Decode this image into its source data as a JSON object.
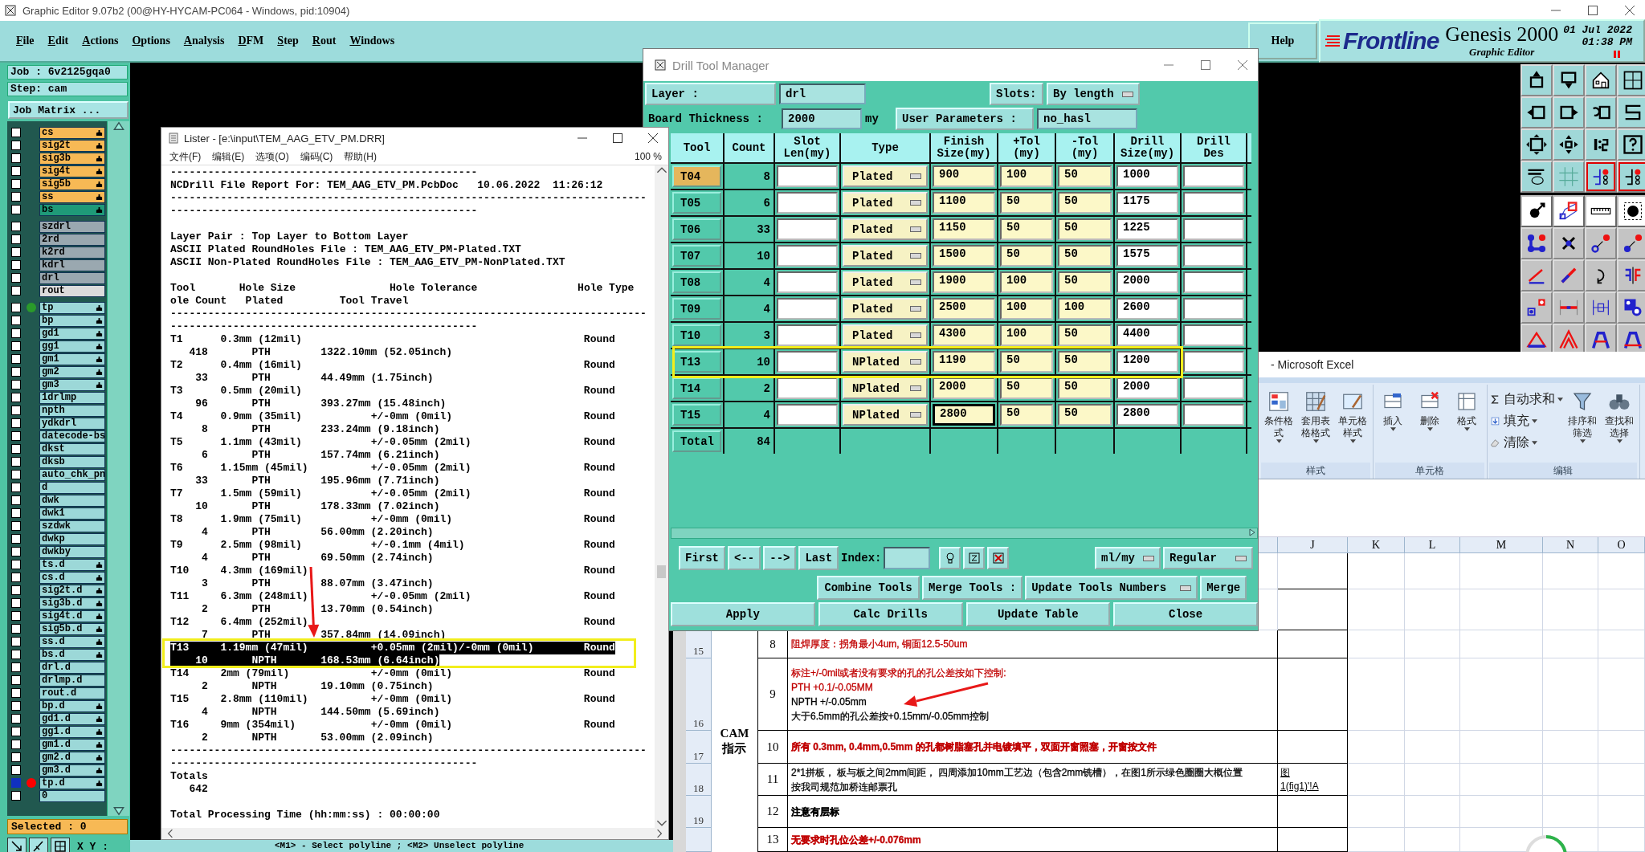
{
  "window": {
    "title": "Graphic Editor 9.07b2 (00@HY-HYCAM-PC064 - Windows, pid:10904)"
  },
  "menu": [
    "File",
    "Edit",
    "Actions",
    "Options",
    "Analysis",
    "DFM",
    "Step",
    "Rout",
    "Windows"
  ],
  "help": "Help",
  "brand": {
    "logo": "Frontline",
    "product": "Genesis 2000",
    "subtitle": "Graphic Editor",
    "date": "01 Jul 2022",
    "time": "01:38 PM"
  },
  "job": {
    "job": "Job : 6v2125gqa0",
    "step": "Step: cam",
    "matrix_button": "Job Matrix ...",
    "selected": "Selected : 0",
    "xy_label": "X Y :"
  },
  "layer_groups": [
    {
      "layers": [
        {
          "name": "cs",
          "kind": "board",
          "affected": true,
          "checked": false,
          "selected": false
        },
        {
          "name": "sig2t",
          "kind": "board",
          "affected": true,
          "checked": false,
          "selected": false
        },
        {
          "name": "sig3b",
          "kind": "board",
          "affected": true,
          "checked": false,
          "selected": false
        },
        {
          "name": "sig4t",
          "kind": "board",
          "affected": true,
          "checked": false,
          "selected": false
        },
        {
          "name": "sig5b",
          "kind": "board",
          "affected": true,
          "checked": false,
          "selected": false
        },
        {
          "name": "ss",
          "kind": "board",
          "affected": true,
          "checked": false,
          "selected": false
        },
        {
          "name": "bs",
          "kind": "board",
          "affected": true,
          "checked": false,
          "selected": true
        }
      ]
    },
    {
      "layers": [
        {
          "name": "szdrl",
          "kind": "drill",
          "affected": false,
          "checked": false,
          "selected": false
        },
        {
          "name": "2rd",
          "kind": "drill",
          "affected": false,
          "checked": false,
          "selected": false
        },
        {
          "name": "k2rd",
          "kind": "drill",
          "affected": false,
          "checked": false,
          "selected": false
        },
        {
          "name": "kdrl",
          "kind": "drill",
          "affected": false,
          "checked": false,
          "selected": false
        },
        {
          "name": "drl",
          "kind": "drill",
          "affected": false,
          "checked": false,
          "selected": false
        },
        {
          "name": "rout",
          "kind": "rout",
          "affected": false,
          "checked": false,
          "selected": false
        }
      ]
    },
    {
      "layers": [
        {
          "name": "tp",
          "kind": "misc",
          "affected": true,
          "checked": false,
          "selected": false,
          "color": "#2a9a2a"
        },
        {
          "name": "bp",
          "kind": "misc",
          "affected": true,
          "checked": false,
          "selected": false
        },
        {
          "name": "gd1",
          "kind": "misc",
          "affected": true,
          "checked": false,
          "selected": false
        },
        {
          "name": "gg1",
          "kind": "misc",
          "affected": true,
          "checked": false,
          "selected": false
        },
        {
          "name": "gm1",
          "kind": "misc",
          "affected": true,
          "checked": false,
          "selected": false
        },
        {
          "name": "gm2",
          "kind": "misc",
          "affected": true,
          "checked": false,
          "selected": false
        },
        {
          "name": "gm3",
          "kind": "misc",
          "affected": true,
          "checked": false,
          "selected": false
        },
        {
          "name": "1drlmp",
          "kind": "misc",
          "affected": false,
          "checked": false,
          "selected": false
        },
        {
          "name": "npth",
          "kind": "misc",
          "affected": false,
          "checked": false,
          "selected": false
        },
        {
          "name": "ydkdrl",
          "kind": "misc",
          "affected": false,
          "checked": false,
          "selected": false
        },
        {
          "name": "datecode-bs",
          "kind": "misc",
          "affected": false,
          "checked": false,
          "selected": false
        },
        {
          "name": "dkst",
          "kind": "misc",
          "affected": false,
          "checked": false,
          "selected": false
        },
        {
          "name": "dksb",
          "kind": "misc",
          "affected": false,
          "checked": false,
          "selected": false
        },
        {
          "name": "auto_chk_pn",
          "kind": "misc",
          "affected": false,
          "checked": false,
          "selected": false
        },
        {
          "name": "d",
          "kind": "misc",
          "affected": false,
          "checked": false,
          "selected": false
        },
        {
          "name": "dwk",
          "kind": "misc",
          "affected": false,
          "checked": false,
          "selected": false
        },
        {
          "name": "dwk1",
          "kind": "misc",
          "affected": false,
          "checked": false,
          "selected": false
        },
        {
          "name": "szdwk",
          "kind": "misc",
          "affected": false,
          "checked": false,
          "selected": false
        },
        {
          "name": "dwkp",
          "kind": "misc",
          "affected": false,
          "checked": false,
          "selected": false
        },
        {
          "name": "dwkby",
          "kind": "misc",
          "affected": false,
          "checked": false,
          "selected": false
        },
        {
          "name": "ts.d",
          "kind": "misc",
          "affected": true,
          "checked": false,
          "selected": false
        },
        {
          "name": "cs.d",
          "kind": "misc",
          "affected": true,
          "checked": false,
          "selected": false
        },
        {
          "name": "sig2t.d",
          "kind": "misc",
          "affected": true,
          "checked": false,
          "selected": false
        },
        {
          "name": "sig3b.d",
          "kind": "misc",
          "affected": true,
          "checked": false,
          "selected": false
        },
        {
          "name": "sig4t.d",
          "kind": "misc",
          "affected": true,
          "checked": false,
          "selected": false
        },
        {
          "name": "sig5b.d",
          "kind": "misc",
          "affected": true,
          "checked": false,
          "selected": false
        },
        {
          "name": "ss.d",
          "kind": "misc",
          "affected": true,
          "checked": false,
          "selected": false
        },
        {
          "name": "bs.d",
          "kind": "misc",
          "affected": true,
          "checked": false,
          "selected": false
        },
        {
          "name": "drl.d",
          "kind": "misc",
          "affected": false,
          "checked": false,
          "selected": false
        },
        {
          "name": "drlmp.d",
          "kind": "misc",
          "affected": false,
          "checked": false,
          "selected": false
        },
        {
          "name": "rout.d",
          "kind": "misc",
          "affected": false,
          "checked": false,
          "selected": false
        },
        {
          "name": "bp.d",
          "kind": "misc",
          "affected": true,
          "checked": false,
          "selected": false
        },
        {
          "name": "gd1.d",
          "kind": "misc",
          "affected": true,
          "checked": false,
          "selected": false
        },
        {
          "name": "gg1.d",
          "kind": "misc",
          "affected": true,
          "checked": false,
          "selected": false
        },
        {
          "name": "gm1.d",
          "kind": "misc",
          "affected": true,
          "checked": false,
          "selected": false
        },
        {
          "name": "gm2.d",
          "kind": "misc",
          "affected": true,
          "checked": false,
          "selected": false
        },
        {
          "name": "gm3.d",
          "kind": "misc",
          "affected": true,
          "checked": false,
          "selected": false
        },
        {
          "name": "tp.d",
          "kind": "misc",
          "affected": true,
          "checked": true,
          "selected": false,
          "color": "#ff0000"
        },
        {
          "name": "0",
          "kind": "misc",
          "affected": false,
          "checked": false,
          "selected": false
        }
      ]
    }
  ],
  "lister": {
    "title": "Lister - [e:\\input\\TEM_AAG_ETV_PM.DRR]",
    "menu": [
      "文件(F)",
      "编辑(E)",
      "选项(O)",
      "编码(C)",
      "帮助(H)"
    ],
    "zoom": "100 %",
    "body": [
      {
        "kind": "text",
        "text": "-------------------------------------------------"
      },
      {
        "kind": "text",
        "text": "NCDrill File Report For: TEM_AAG_ETV_PM.PcbDoc   10.06.2022  11:26:12"
      },
      {
        "kind": "text",
        "text": "----------------------------------------------------------------------------"
      },
      {
        "kind": "text",
        "text": "-------------------------------------------------"
      },
      {
        "kind": "blank"
      },
      {
        "kind": "text",
        "text": "Layer Pair : Top Layer to Bottom Layer"
      },
      {
        "kind": "text",
        "text": "ASCII Plated RoundHoles File : TEM_AAG_ETV_PM-Plated.TXT"
      },
      {
        "kind": "text",
        "text": "ASCII Non-Plated RoundHoles File : TEM_AAG_ETV_PM-NonPlated.TXT"
      },
      {
        "kind": "blank"
      },
      {
        "kind": "text",
        "text": "Tool       Hole Size               Hole Tolerance                Hole Type"
      },
      {
        "kind": "text",
        "text": "ole Count   Plated         Tool Travel"
      },
      {
        "kind": "text",
        "text": "----------------------------------------------------------------------------"
      },
      {
        "kind": "text",
        "text": "-------------------------------------------------"
      },
      {
        "kind": "tool",
        "tool": "T1",
        "size": "0.3mm (12mil)",
        "type": "Round",
        "count": "418",
        "plating": "PTH",
        "travel": "1322.10mm (52.05inch)",
        "selected": false
      },
      {
        "kind": "tool",
        "tool": "T2",
        "size": "0.4mm (16mil)",
        "type": "Round",
        "count": "33",
        "plating": "PTH",
        "travel": "44.49mm (1.75inch)",
        "selected": false
      },
      {
        "kind": "tool",
        "tool": "T3",
        "size": "0.5mm (20mil)",
        "type": "Round",
        "count": "96",
        "plating": "PTH",
        "travel": "393.27mm (15.48inch)",
        "selected": false
      },
      {
        "kind": "tool",
        "tool": "T4",
        "size": "0.9mm (35mil)",
        "tolerance": "+/-0mm (0mil)",
        "type": "Round",
        "count": "8",
        "plating": "PTH",
        "travel": "233.24mm (9.18inch)",
        "selected": false
      },
      {
        "kind": "tool",
        "tool": "T5",
        "size": "1.1mm (43mil)",
        "tolerance": "+/-0.05mm (2mil)",
        "type": "Round",
        "count": "6",
        "plating": "PTH",
        "travel": "157.74mm (6.21inch)",
        "selected": false
      },
      {
        "kind": "tool",
        "tool": "T6",
        "size": "1.15mm (45mil)",
        "tolerance": "+/-0.05mm (2mil)",
        "type": "Round",
        "count": "33",
        "plating": "PTH",
        "travel": "195.96mm (7.71inch)",
        "selected": false
      },
      {
        "kind": "tool",
        "tool": "T7",
        "size": "1.5mm (59mil)",
        "tolerance": "+/-0.05mm (2mil)",
        "type": "Round",
        "count": "10",
        "plating": "PTH",
        "travel": "178.33mm (7.02inch)",
        "selected": false
      },
      {
        "kind": "tool",
        "tool": "T8",
        "size": "1.9mm (75mil)",
        "tolerance": "+/-0mm (0mil)",
        "type": "Round",
        "count": "4",
        "plating": "PTH",
        "travel": "56.00mm (2.20inch)",
        "selected": false
      },
      {
        "kind": "tool",
        "tool": "T9",
        "size": "2.5mm (98mil)",
        "tolerance": "+/-0.1mm (4mil)",
        "type": "Round",
        "count": "4",
        "plating": "PTH",
        "travel": "69.50mm (2.74inch)",
        "selected": false
      },
      {
        "kind": "tool",
        "tool": "T10",
        "size": "4.3mm (169mil)",
        "type": "Round",
        "count": "3",
        "plating": "PTH",
        "travel": "88.07mm (3.47inch)",
        "selected": false
      },
      {
        "kind": "tool",
        "tool": "T11",
        "size": "6.3mm (248mil)",
        "tolerance": "+/-0.05mm (2mil)",
        "type": "Round",
        "count": "2",
        "plating": "PTH",
        "travel": "13.70mm (0.54inch)",
        "selected": false
      },
      {
        "kind": "tool",
        "tool": "T12",
        "size": "6.4mm (252mil)",
        "type": "Round",
        "count": "7",
        "plating": "PTH",
        "travel": "357.84mm (14.09inch)",
        "selected": false
      },
      {
        "kind": "tool",
        "tool": "T13",
        "size": "1.19mm (47mil)",
        "tolerance": "+0.05mm (2mil)/-0mm (0mil)",
        "type": "Round",
        "count": "10",
        "plating": "NPTH",
        "travel": "168.53mm (6.64inch)",
        "selected": true
      },
      {
        "kind": "tool",
        "tool": "T14",
        "size": "2mm (79mil)",
        "tolerance": "+/-0mm (0mil)",
        "type": "Round",
        "count": "2",
        "plating": "NPTH",
        "travel": "19.10mm (0.75inch)",
        "selected": false
      },
      {
        "kind": "tool",
        "tool": "T15",
        "size": "2.8mm (110mil)",
        "tolerance": "+/-0mm (0mil)",
        "type": "Round",
        "count": "4",
        "plating": "NPTH",
        "travel": "144.50mm (5.69inch)",
        "selected": false
      },
      {
        "kind": "tool",
        "tool": "T16",
        "size": "9mm (354mil)",
        "tolerance": "+/-0mm (0mil)",
        "type": "Round",
        "count": "2",
        "plating": "NPTH",
        "travel": "53.00mm (2.09inch)",
        "selected": false
      },
      {
        "kind": "text",
        "text": "----------------------------------------------------------------------------"
      },
      {
        "kind": "text",
        "text": "-------------------------------------------------"
      },
      {
        "kind": "text",
        "text": "Totals"
      },
      {
        "kind": "text",
        "text": "   642"
      },
      {
        "kind": "blank"
      },
      {
        "kind": "text",
        "text": "Total Processing Time (hh:mm:ss) : 00:00:00"
      }
    ]
  },
  "drill_manager": {
    "title": "Drill Tool Manager",
    "layer_label": "Layer :",
    "layer": "drl",
    "slots_label": "Slots:",
    "slots": "By length",
    "thickness_label": "Board Thickness :",
    "thickness": "2000",
    "thickness_unit": "my",
    "user_params_button": "User Parameters :",
    "user_params": "no_hasl",
    "columns": [
      "Tool",
      "Count",
      "Slot\nLen(my)",
      "Type",
      "Finish\nSize(my)",
      "+Tol\n(my)",
      "-Tol\n(my)",
      "Drill\nSize(my)",
      "Drill\nDes"
    ],
    "rows": [
      {
        "tool": "T04",
        "count": "8",
        "type": "Plated",
        "finish": "900",
        "plus_tol": "100",
        "minus_tol": "50",
        "drill_size": "1000",
        "selected": true,
        "focused": false
      },
      {
        "tool": "T05",
        "count": "6",
        "type": "Plated",
        "finish": "1100",
        "plus_tol": "50",
        "minus_tol": "50",
        "drill_size": "1175",
        "selected": false,
        "focused": false
      },
      {
        "tool": "T06",
        "count": "33",
        "type": "Plated",
        "finish": "1150",
        "plus_tol": "50",
        "minus_tol": "50",
        "drill_size": "1225",
        "selected": false,
        "focused": false
      },
      {
        "tool": "T07",
        "count": "10",
        "type": "Plated",
        "finish": "1500",
        "plus_tol": "50",
        "minus_tol": "50",
        "drill_size": "1575",
        "selected": false,
        "focused": false
      },
      {
        "tool": "T08",
        "count": "4",
        "type": "Plated",
        "finish": "1900",
        "plus_tol": "100",
        "minus_tol": "50",
        "drill_size": "2000",
        "selected": false,
        "focused": false
      },
      {
        "tool": "T09",
        "count": "4",
        "type": "Plated",
        "finish": "2500",
        "plus_tol": "100",
        "minus_tol": "100",
        "drill_size": "2600",
        "selected": false,
        "focused": false
      },
      {
        "tool": "T10",
        "count": "3",
        "type": "Plated",
        "finish": "4300",
        "plus_tol": "100",
        "minus_tol": "50",
        "drill_size": "4400",
        "selected": false,
        "focused": false
      },
      {
        "tool": "T13",
        "count": "10",
        "type": "NPlated",
        "finish": "1190",
        "plus_tol": "50",
        "minus_tol": "50",
        "drill_size": "1200",
        "selected": false,
        "focused": false
      },
      {
        "tool": "T14",
        "count": "2",
        "type": "NPlated",
        "finish": "2000",
        "plus_tol": "50",
        "minus_tol": "50",
        "drill_size": "2000",
        "selected": false,
        "focused": false
      },
      {
        "tool": "T15",
        "count": "4",
        "type": "NPlated",
        "finish": "2800",
        "plus_tol": "50",
        "minus_tol": "50",
        "drill_size": "2800",
        "selected": false,
        "focused": true
      }
    ],
    "total": {
      "label": "Total",
      "count": "84"
    },
    "nav": [
      "First",
      "<--",
      "-->",
      "Last"
    ],
    "index_label": "Index:",
    "units": "ml/my",
    "mode": "Regular",
    "combine": "Combine Tools",
    "merge_label": "Merge Tools :",
    "merge_mode": "Update Tools Numbers",
    "merge": "Merge",
    "actions": [
      "Apply",
      "Calc Drills",
      "Update Table",
      "Close"
    ]
  },
  "excel": {
    "title": "- Microsoft Excel",
    "groups": [
      {
        "label": "样式",
        "tools": [
          {
            "label": "条件格式",
            "kind": "large"
          },
          {
            "label": "套用表格格式",
            "kind": "large"
          },
          {
            "label": "单元格样式",
            "kind": "large"
          }
        ]
      },
      {
        "label": "单元格",
        "tools": [
          {
            "label": "插入",
            "kind": "large"
          },
          {
            "label": "删除",
            "kind": "large"
          },
          {
            "label": "格式",
            "kind": "large"
          }
        ]
      },
      {
        "label": "编辑",
        "tools": [
          {
            "label": "自动求和",
            "kind": "small"
          },
          {
            "label": "填充",
            "kind": "small"
          },
          {
            "label": "清除",
            "kind": "small"
          },
          {
            "label": "排序和筛选",
            "kind": "large"
          },
          {
            "label": "查找和选择",
            "kind": "large"
          }
        ]
      }
    ],
    "columns": [
      "J",
      "K",
      "L",
      "M",
      "N",
      "O"
    ],
    "section": "CAM\n指示",
    "rows": [
      {
        "header": "15",
        "number": "8",
        "bold": false,
        "lines": [
          {
            "text": "阻焊厚度：拐角最小4um, 铜面12.5-50um",
            "color": "#c00000"
          }
        ]
      },
      {
        "header": "16",
        "number": "9",
        "bold": false,
        "lines": [
          {
            "text": "标注+/-0mil或者没有要求的孔的孔公差按如下控制:",
            "color": "#c00000"
          },
          {
            "text": "PTH +0.1/-0.05MM",
            "color": "#c00000"
          },
          {
            "text": "NPTH +/-0.05mm",
            "color": "#000000"
          },
          {
            "text": "大于6.5mm的孔公差按+0.15mm/-0.05mm控制",
            "color": "#000000"
          }
        ]
      },
      {
        "header": "17",
        "number": "10",
        "bold": true,
        "lines": [
          {
            "text": "所有 0.3mm, 0.4mm,0.5mm 的孔都树脂塞孔并电镀填平，双面开窗照塞，开窗按文件",
            "color": "#c00000"
          }
        ]
      },
      {
        "header": "18",
        "number": "11",
        "bold": false,
        "lines": [
          {
            "text": "2*1拼板， 板与板之间2mm间距， 四周添加10mm工艺边（包含2mm铣槽），在图1所示绿色圈圈大概位置",
            "color": "#000000"
          },
          {
            "text": "按我司规范加桥连邮票孔",
            "color": "#000000"
          }
        ],
        "link": "图\n1(fig1)'!A"
      },
      {
        "header": "19",
        "number": "12",
        "bold": true,
        "lines": [
          {
            "text": "注意有层标",
            "color": "#000000"
          }
        ]
      },
      {
        "number": "13",
        "bold": true,
        "lines": [
          {
            "text": "无要求时孔位公差+/-0.076mm",
            "color": "#c00000"
          }
        ]
      }
    ]
  },
  "status": "<M1> - Select polyline ; <M2> Unselect polyline"
}
